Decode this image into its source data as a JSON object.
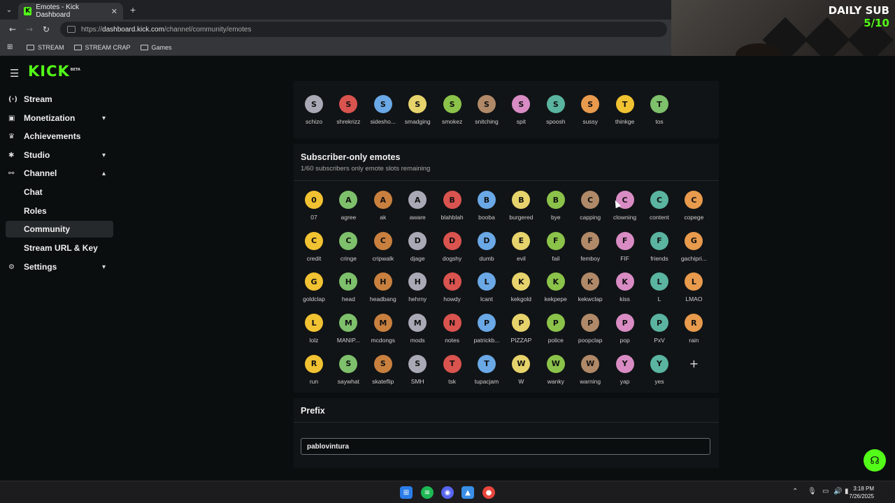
{
  "browser": {
    "tab_title": "Emotes - Kick Dashboard",
    "tab_favicon": "K",
    "url_prefix": "https://",
    "url_host": "dashboard.kick.com",
    "url_path": "/channel/community/emotes",
    "bookmarks": [
      "STREAM",
      "STREAM CRAP",
      "Games"
    ]
  },
  "overlay": {
    "line1": "DAILY SUB",
    "line2": "5/10"
  },
  "sidebar": {
    "logo": "KICK",
    "logo_badge": "BETA",
    "items": [
      {
        "label": "Stream",
        "icon": "broadcast-icon"
      },
      {
        "label": "Monetization",
        "icon": "monetization-icon",
        "chevron": "▾"
      },
      {
        "label": "Achievements",
        "icon": "trophy-icon"
      },
      {
        "label": "Studio",
        "icon": "studio-icon",
        "chevron": "▾"
      },
      {
        "label": "Channel",
        "icon": "channel-icon",
        "chevron": "▴"
      }
    ],
    "channel_sub": [
      "Chat",
      "Roles",
      "Community",
      "Stream URL & Key"
    ],
    "settings": {
      "label": "Settings",
      "icon": "gear-icon",
      "chevron": "▾"
    }
  },
  "global_emotes_tail": [
    "schizo",
    "shrekrizz",
    "sidesho...",
    "smadging",
    "smokez",
    "snitching",
    "spit",
    "spoosh",
    "sussy",
    "thinkge",
    "tos"
  ],
  "subscriber_section": {
    "title": "Subscriber-only emotes",
    "subtitle": "1/60 subscribers only emote slots remaining",
    "emotes": [
      "07",
      "agree",
      "ak",
      "aware",
      "blahblah",
      "booba",
      "burgered",
      "bye",
      "capping",
      "clowning",
      "content",
      "copege",
      "credit",
      "cringe",
      "cripwalk",
      "djage",
      "dogshy",
      "dumb",
      "evil",
      "fail",
      "femboy",
      "FIF",
      "friends",
      "gachipri...",
      "goldclap",
      "head",
      "headbang",
      "hehrny",
      "howdy",
      "lcant",
      "kekgold",
      "kekpepe",
      "kekwclap",
      "kiss",
      "L",
      "LMAO",
      "lolz",
      "MANIP...",
      "mcdongs",
      "mods",
      "notes",
      "patrickb...",
      "PIZZAP",
      "police",
      "poopclap",
      "pop",
      "PxV",
      "rain",
      "run",
      "saywhat",
      "skateflip",
      "SMH",
      "tsk",
      "tupacjam",
      "W",
      "wanky",
      "warning",
      "yap",
      "yes"
    ],
    "add_label": "+"
  },
  "prefix_section": {
    "title": "Prefix",
    "value": "pablovintura"
  },
  "taskbar": {
    "time": "3:18 PM",
    "date": "7/26/2025"
  },
  "colors": {
    "accent": "#53fc18",
    "background": "#0b0e0f",
    "panel": "#111416"
  }
}
